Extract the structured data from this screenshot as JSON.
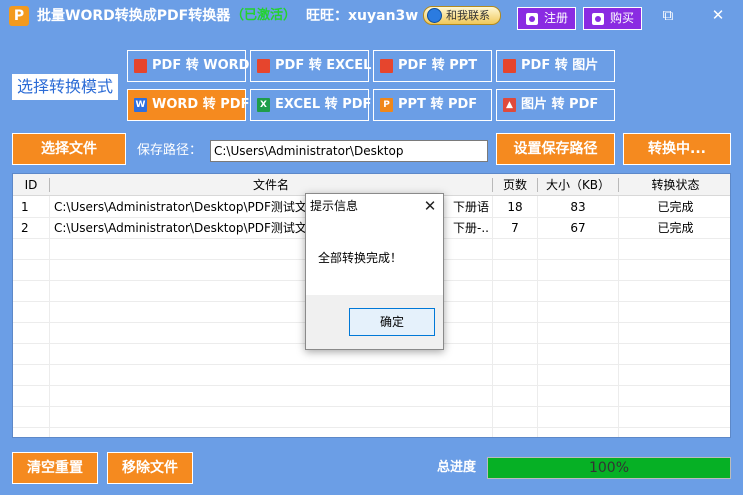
{
  "titlebar": {
    "app_icon": "P",
    "title": "批量WORD转换成PDF转换器",
    "status": "（已激活）",
    "wangwang": "旺旺：xuyan3w",
    "contact": "和我联系",
    "register": "注册",
    "buy": "购买",
    "minimize_glyph": "⧉",
    "close_glyph": "✕"
  },
  "mode": {
    "label": "选择转换模式",
    "buttons": [
      {
        "label": "PDF 转 WORD",
        "icon": "pdf-icon",
        "glyph": "⬚",
        "active": false
      },
      {
        "label": "PDF 转 EXCEL",
        "icon": "pdf-icon",
        "glyph": "⬚",
        "active": false
      },
      {
        "label": "PDF 转 PPT",
        "icon": "pdf-icon",
        "glyph": "⬚",
        "active": false
      },
      {
        "label": "PDF 转 图片",
        "icon": "pdf-icon",
        "glyph": "⬚",
        "active": false
      },
      {
        "label": "WORD 转 PDF",
        "icon": "word-icon",
        "glyph": "W",
        "active": true
      },
      {
        "label": "EXCEL 转 PDF",
        "icon": "excel-icon",
        "glyph": "X",
        "active": false
      },
      {
        "label": "PPT 转 PDF",
        "icon": "ppt-icon",
        "glyph": "P",
        "active": false
      },
      {
        "label": "图片 转 PDF",
        "icon": "image-icon",
        "glyph": "▲",
        "active": false
      }
    ]
  },
  "files": {
    "select_button": "选择文件",
    "path_label": "保存路径：",
    "path_value": "C:\\Users\\Administrator\\Desktop",
    "set_path_button": "设置保存路径",
    "convert_button": "转换中..."
  },
  "table": {
    "columns": [
      "ID",
      "文件名",
      "页数",
      "大小（KB）",
      "转换状态"
    ],
    "rows": [
      {
        "id": "1",
        "name": "C:\\Users\\Administrator\\Desktop\\PDF测试文",
        "name_tail": "下册语...",
        "pages": "18",
        "size": "83",
        "status": "已完成"
      },
      {
        "id": "2",
        "name": "C:\\Users\\Administrator\\Desktop\\PDF测试文",
        "name_tail": "下册-...",
        "pages": "7",
        "size": "67",
        "status": "已完成"
      }
    ]
  },
  "dialog": {
    "title": "提示信息",
    "close_glyph": "✕",
    "message": "全部转换完成！",
    "ok": "确定"
  },
  "bottom": {
    "clear_button": "清空重置",
    "remove_button": "移除文件",
    "progress_label": "总进度",
    "progress_text": "100%",
    "progress_value": 1.0
  },
  "colors": {
    "background": "#6b9ee6",
    "accent_orange": "#f58a1f",
    "purple": "#8a2be2",
    "progress_green": "#06b025"
  }
}
